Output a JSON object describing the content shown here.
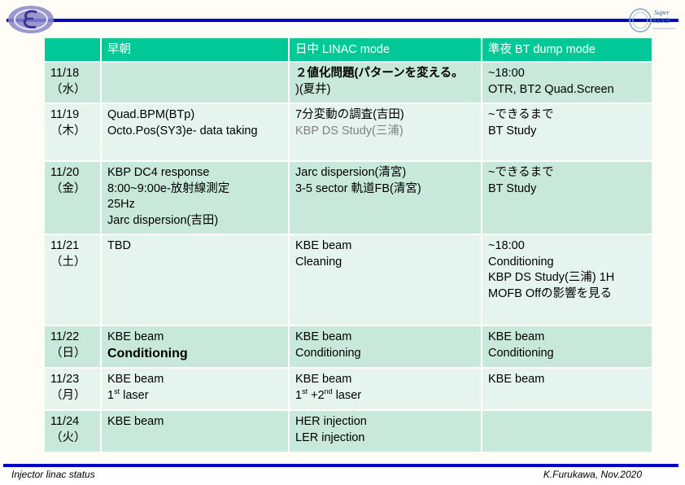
{
  "footer": {
    "left": "Injector linac status",
    "right": "K.Furukawa, Nov.2020"
  },
  "logos": {
    "left": "KEK epsilon logo",
    "right": {
      "line1": "Super",
      "line2": "KEKB"
    }
  },
  "colors": {
    "header_bg": "#00c896",
    "row_dark": "#c8e8dc",
    "row_light": "#e6f4ef",
    "rule_blue": "#0000cc",
    "page_bg": "#fffdf5"
  },
  "table": {
    "headers": [
      "",
      "早朝",
      "日中 LINAC mode",
      "準夜 BT dump mode"
    ],
    "rows": [
      {
        "date": "11/18",
        "dow": "（水）",
        "early": [],
        "day": [
          "２値化問題(パターンを変える。",
          ")(夏井)"
        ],
        "night": [
          "~18:00",
          "OTR, BT2 Quad.Screen"
        ]
      },
      {
        "date": "11/19",
        "dow": "（木）",
        "early": [
          "Quad.BPM(BTp)",
          "Octo.Pos(SY3)e- data taking"
        ],
        "day": [
          "7分変動の調査(吉田)",
          "KBP DS Study(三浦)"
        ],
        "night": [
          "~できるまで",
          "BT Study"
        ]
      },
      {
        "date": "11/20",
        "dow": "（金）",
        "early": [
          "KBP DC4 response",
          "8:00~9:00e-放射線測定",
          "25Hz",
          "Jarc dispersion(吉田)"
        ],
        "day": [
          "Jarc dispersion(清宮)",
          "3-5 sector 軌道FB(清宮)"
        ],
        "night": [
          "~できるまで",
          "BT Study"
        ]
      },
      {
        "date": "11/21",
        "dow": "（土）",
        "early": [
          "TBD"
        ],
        "day": [
          "KBE beam",
          "Cleaning"
        ],
        "night": [
          "~18:00",
          "Conditioning",
          "KBP DS Study(三浦) 1H",
          "MOFB Offの影響を見る"
        ]
      },
      {
        "date": "11/22",
        "dow": "（日）",
        "early": [
          "KBE beam",
          "Conditioning"
        ],
        "day": [
          "KBE beam",
          "Conditioning"
        ],
        "night": [
          "KBE beam",
          "Conditioning"
        ]
      },
      {
        "date": "11/23",
        "dow": "（月）",
        "early": [
          "KBE beam",
          "1",
          "st",
          " laser"
        ],
        "day": [
          "KBE beam",
          "1",
          "st",
          " +2",
          "nd",
          " laser"
        ],
        "night": [
          "KBE beam"
        ]
      },
      {
        "date": "11/24",
        "dow": "（火）",
        "early": [
          "KBE beam"
        ],
        "day": [
          "HER injection",
          "LER injection"
        ],
        "night": []
      }
    ]
  }
}
